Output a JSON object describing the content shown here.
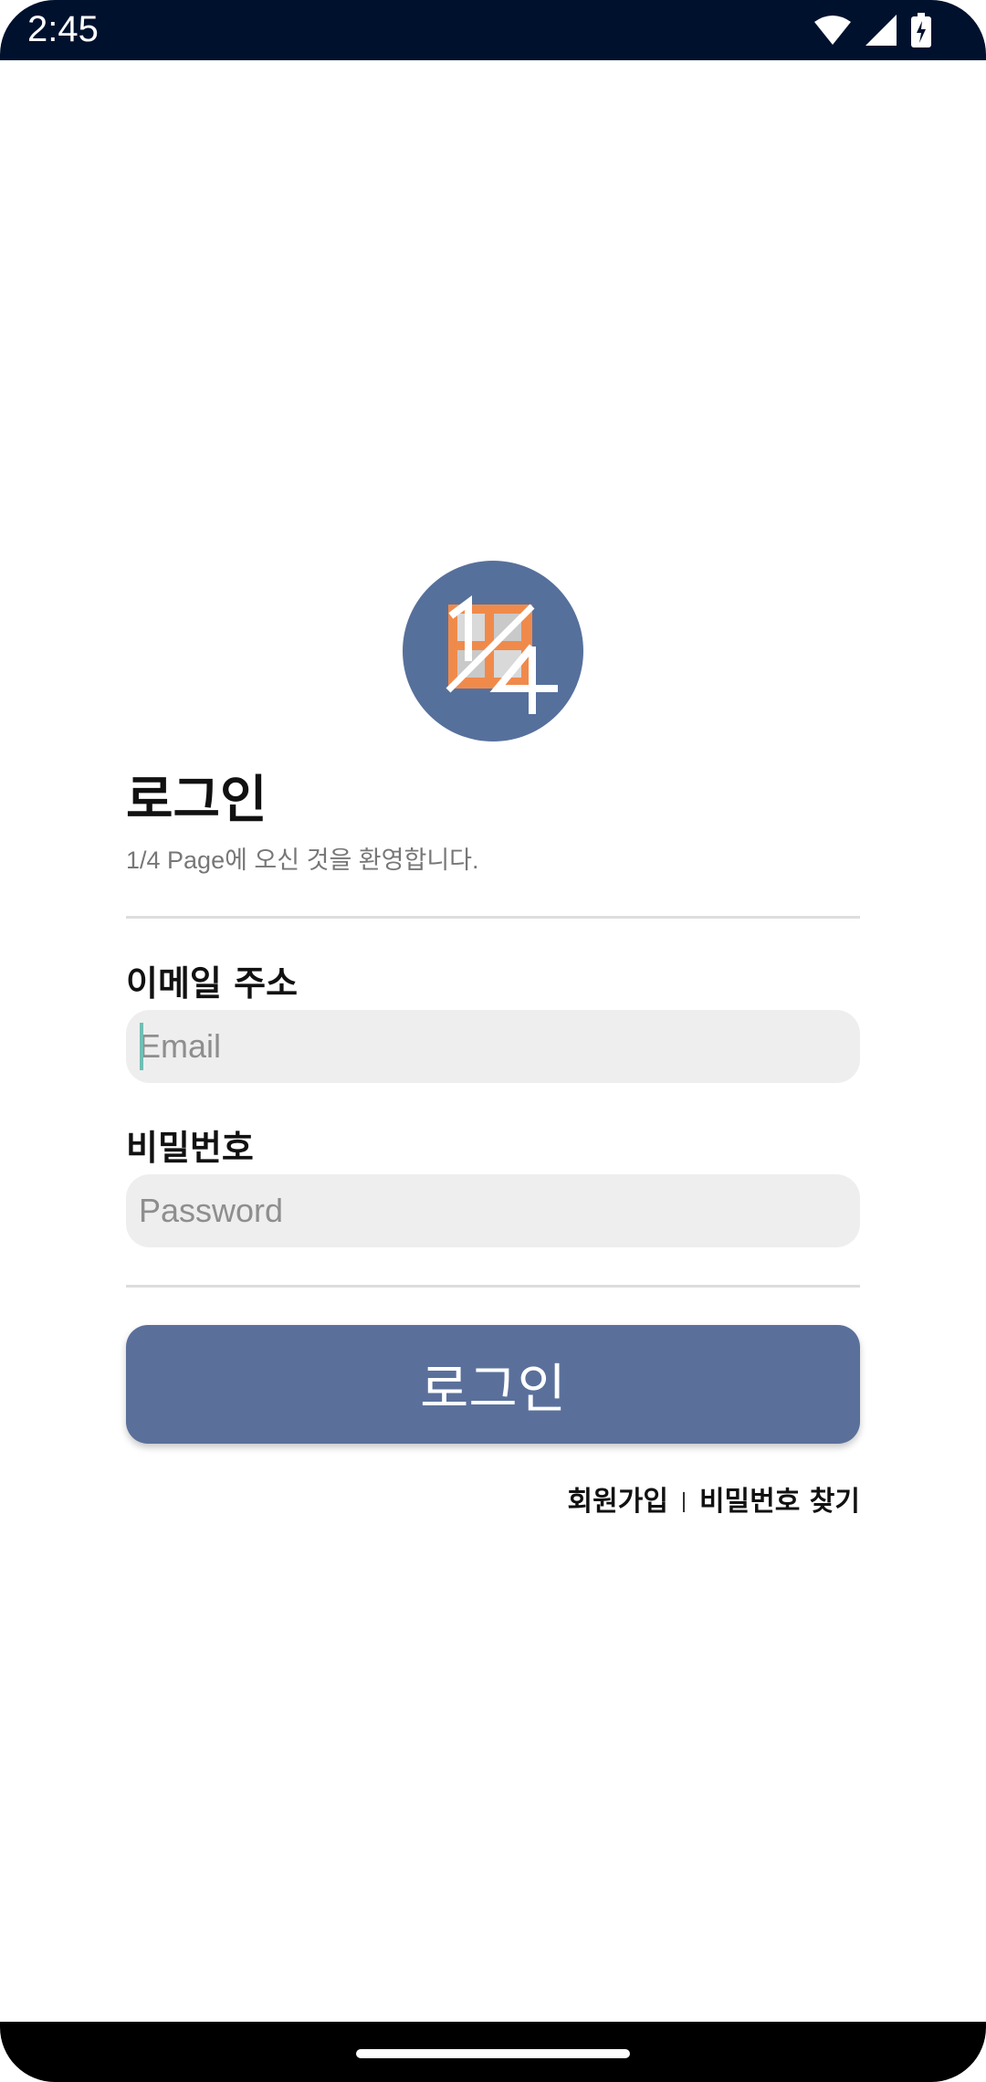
{
  "status_bar": {
    "time": "2:45",
    "icons": [
      "wifi-icon",
      "signal-icon",
      "battery-charging-icon"
    ]
  },
  "logo": {
    "text": "1/4",
    "colors": {
      "circle": "#56709c",
      "grid": "#f08a4b"
    }
  },
  "header": {
    "title": "로그인",
    "subtitle": "1/4 Page에 오신 것을 환영합니다."
  },
  "form": {
    "email": {
      "label": "이메일 주소",
      "placeholder": "Email",
      "value": ""
    },
    "password": {
      "label": "비밀번호",
      "placeholder": "Password",
      "value": ""
    },
    "submit_label": "로그인"
  },
  "links": {
    "signup": "회원가입",
    "find_password": "비밀번호 찾기"
  },
  "colors": {
    "status_bar": "#00112e",
    "accent": "#5a709b",
    "input_bg": "#eeeeee",
    "caret": "#6fbfb4"
  }
}
